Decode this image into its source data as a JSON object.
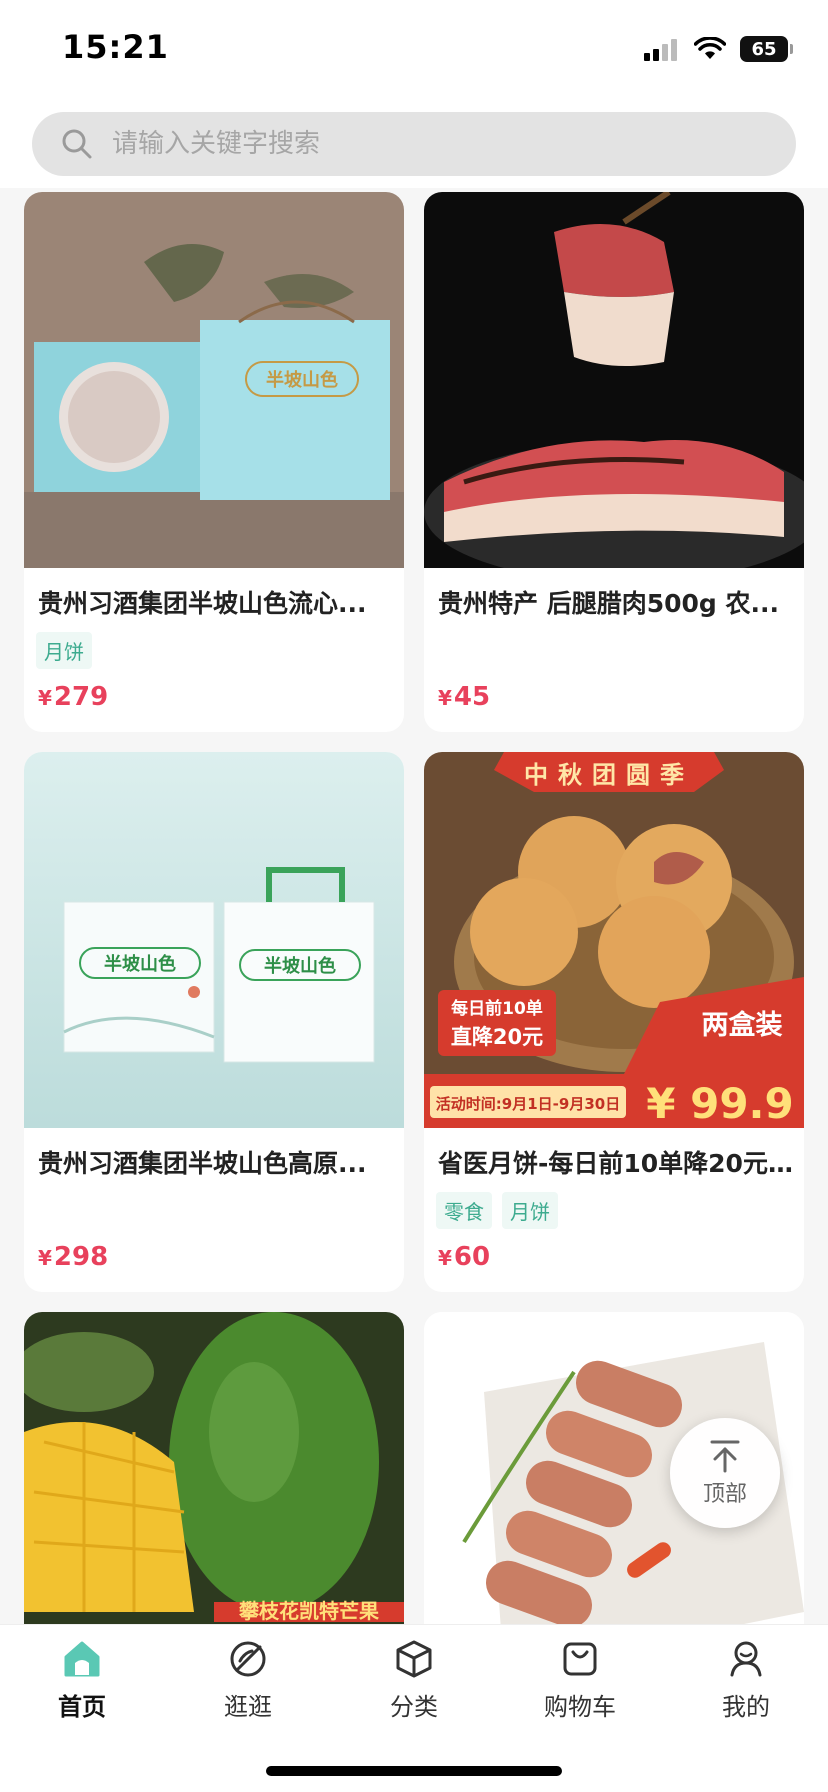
{
  "status_bar": {
    "time": "15:21",
    "battery": "65"
  },
  "search": {
    "placeholder": "请输入关键字搜索"
  },
  "products": [
    {
      "title": "贵州习酒集团半坡山色流心...",
      "tags": [
        "月饼"
      ],
      "currency": "¥",
      "price": "279",
      "image": "mooncake-gift-box-blue"
    },
    {
      "title": "贵州特产 后腿腊肉500g 农...",
      "tags": [],
      "currency": "¥",
      "price": "45",
      "image": "cured-pork-slices"
    },
    {
      "title": "贵州习酒集团半坡山色高原...",
      "tags": [],
      "currency": "¥",
      "price": "298",
      "image": "mooncake-gift-box-white"
    },
    {
      "title": "省医月饼-每日前10单降20元...",
      "tags": [
        "零食",
        "月饼"
      ],
      "currency": "¥",
      "price": "60",
      "image": "mooncake-basket",
      "banner": {
        "top": "中秋团圆季",
        "promo_line1": "每日前10单",
        "promo_line2": "直降20元",
        "pack": "两盒装",
        "period": "活动时间:9月1日-9月30日",
        "big_price": "¥ 99.9"
      }
    },
    {
      "title": "",
      "tags": [],
      "currency": "",
      "price": "",
      "image": "green-mango",
      "banner": {
        "text": "攀枝花凯特芒果"
      }
    },
    {
      "title": "",
      "tags": [],
      "currency": "",
      "price": "",
      "image": "sausages-plate"
    }
  ],
  "back_to_top": {
    "label": "顶部",
    "icon": "arrow-up-to-line-icon"
  },
  "tabbar": {
    "items": [
      {
        "label": "首页",
        "icon": "home-icon",
        "active": true
      },
      {
        "label": "逛逛",
        "icon": "compass-icon",
        "active": false
      },
      {
        "label": "分类",
        "icon": "category-cube-icon",
        "active": false
      },
      {
        "label": "购物车",
        "icon": "shopping-bag-icon",
        "active": false
      },
      {
        "label": "我的",
        "icon": "user-icon",
        "active": false
      }
    ]
  },
  "colors": {
    "accent": "#5ac8b4",
    "price": "#e8415c",
    "tag_text": "#3dab8f",
    "tag_bg": "#eef8f5"
  }
}
